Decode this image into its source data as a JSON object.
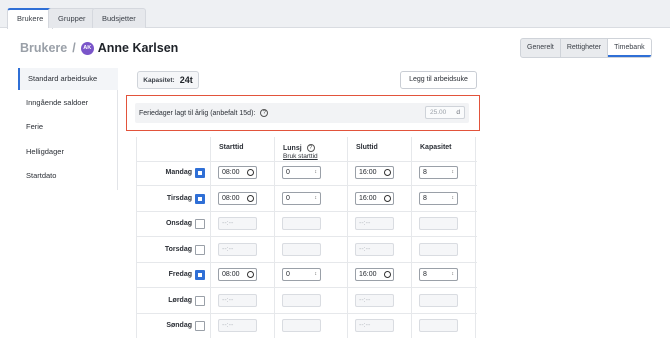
{
  "tabs": [
    {
      "label": "Brukere",
      "active": true
    },
    {
      "label": "Grupper",
      "active": false
    },
    {
      "label": "Budsjetter",
      "active": false
    }
  ],
  "breadcrumb": {
    "parent": "Brukere",
    "separator": "/",
    "avatar_initials": "AK",
    "name": "Anne Karlsen"
  },
  "view_toggle": [
    "Generelt",
    "Rettigheter",
    "Timebank"
  ],
  "sidebar": {
    "items": [
      "Standard arbeidsuke",
      "Inngående saldoer",
      "Ferie",
      "Helligdager",
      "Startdato"
    ]
  },
  "capacity": {
    "label": "Kapasitet:",
    "value": "24t"
  },
  "add_button": "Legg til arbeidsuke",
  "holiday": {
    "label": "Feriedager lagt til årlig (anbefalt 15d):",
    "help": "?",
    "placeholder": "25.00",
    "unit": "d"
  },
  "columns": {
    "start": "Starttid",
    "lunch": "Lunsj",
    "lunch_help": "?",
    "lunch_link": "Bruk starttid",
    "end": "Sluttid",
    "capacity": "Kapasitet"
  },
  "rows": [
    {
      "day": "Mandag",
      "checked": true,
      "start": "08:00",
      "lunch": "0",
      "end": "16:00",
      "capacity": "8"
    },
    {
      "day": "Tirsdag",
      "checked": true,
      "start": "08:00",
      "lunch": "0",
      "end": "16:00",
      "capacity": "8"
    },
    {
      "day": "Onsdag",
      "checked": false,
      "start": "--:--",
      "lunch": "",
      "end": "--:--",
      "capacity": ""
    },
    {
      "day": "Torsdag",
      "checked": false,
      "start": "--:--",
      "lunch": "",
      "end": "--:--",
      "capacity": ""
    },
    {
      "day": "Fredag",
      "checked": true,
      "start": "08:00",
      "lunch": "0",
      "end": "16:00",
      "capacity": "8"
    },
    {
      "day": "Lørdag",
      "checked": false,
      "start": "--:--",
      "lunch": "",
      "end": "--:--",
      "capacity": ""
    },
    {
      "day": "Søndag",
      "checked": false,
      "start": "--:--",
      "lunch": "",
      "end": "--:--",
      "capacity": ""
    }
  ],
  "colors": {
    "accent": "#2f6fd6",
    "highlight_border": "#e2533b",
    "avatar": "#7a55c9"
  }
}
